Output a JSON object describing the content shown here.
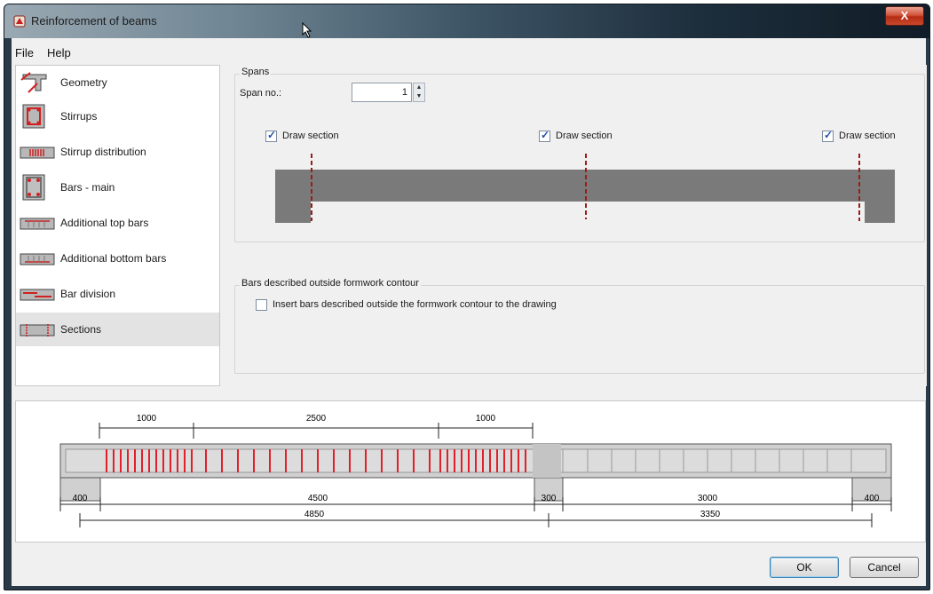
{
  "window": {
    "title": "Reinforcement of beams",
    "close_glyph": "X"
  },
  "menu": {
    "items": [
      "File",
      "Help"
    ]
  },
  "nav": {
    "items": [
      {
        "label": "Geometry",
        "icon": "geometry-icon"
      },
      {
        "label": "Stirrups",
        "icon": "stirrups-icon"
      },
      {
        "label": "Stirrup distribution",
        "icon": "stirrup-distribution-icon"
      },
      {
        "label": "Bars - main",
        "icon": "bars-main-icon"
      },
      {
        "label": "Additional top bars",
        "icon": "additional-top-bars-icon"
      },
      {
        "label": "Additional bottom bars",
        "icon": "additional-bottom-bars-icon"
      },
      {
        "label": "Bar division",
        "icon": "bar-division-icon"
      },
      {
        "label": "Sections",
        "icon": "sections-icon",
        "selected": true
      }
    ]
  },
  "spans": {
    "group_title": "Spans",
    "span_no_label": "Span no.:",
    "span_no_value": "1",
    "draw_section_label": "Draw section",
    "draw_sections": [
      true,
      true,
      true
    ]
  },
  "bars_outside": {
    "group_title": "Bars described outside formwork contour",
    "checkbox_label": "Insert bars described outside the formwork contour to the drawing",
    "checked": false
  },
  "preview": {
    "top_dims": [
      "1000",
      "2500",
      "1000"
    ],
    "bottom_dims_row1": [
      "400",
      "4500",
      "300",
      "3000",
      "400"
    ],
    "bottom_dims_row2": [
      "4850",
      "3350"
    ]
  },
  "buttons": {
    "ok": "OK",
    "cancel": "Cancel"
  },
  "colors": {
    "beam_gray": "#7a7a7a",
    "rebar_red": "#e0202a",
    "section_line": "#9a1c1c",
    "selection": "#e3e3e3"
  }
}
